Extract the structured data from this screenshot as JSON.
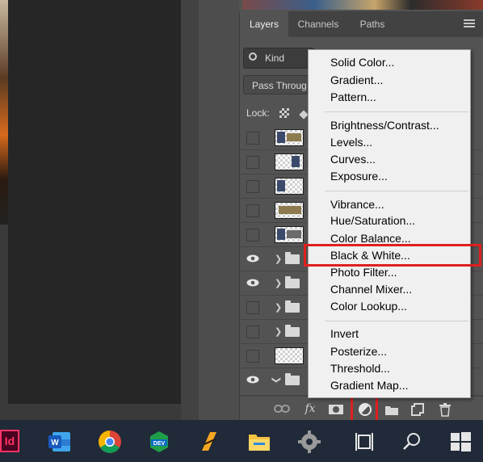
{
  "panel": {
    "tabs": [
      {
        "label": "Layers",
        "active": true
      },
      {
        "label": "Channels",
        "active": false
      },
      {
        "label": "Paths",
        "active": false
      }
    ],
    "filter": {
      "icon": "search-icon",
      "value": "Kind"
    },
    "blend_mode": "Pass Throug",
    "lock_label": "Lock:",
    "layers": [
      {
        "type": "image",
        "visible": false
      },
      {
        "type": "image",
        "visible": false
      },
      {
        "type": "image",
        "visible": false
      },
      {
        "type": "image",
        "visible": false
      },
      {
        "type": "image",
        "visible": false
      },
      {
        "type": "group",
        "visible": true
      },
      {
        "type": "group",
        "visible": true
      },
      {
        "type": "group",
        "visible": false
      },
      {
        "type": "group",
        "visible": false
      },
      {
        "type": "empty",
        "visible": false
      },
      {
        "type": "group-open",
        "visible": true
      }
    ],
    "bottom_tools": [
      "link-icon",
      "fx-icon",
      "mask-icon",
      "adjustment-layer-icon",
      "folder-icon",
      "new-layer-icon",
      "trash-icon"
    ],
    "fx_label": "fx"
  },
  "menu": {
    "groups": [
      [
        "Solid Color...",
        "Gradient...",
        "Pattern..."
      ],
      [
        "Brightness/Contrast...",
        "Levels...",
        "Curves...",
        "Exposure..."
      ],
      [
        "Vibrance...",
        "Hue/Saturation...",
        "Color Balance...",
        "Black & White...",
        "Photo Filter...",
        "Channel Mixer...",
        "Color Lookup..."
      ],
      [
        "Invert",
        "Posterize...",
        "Threshold...",
        "Gradient Map..."
      ]
    ],
    "highlighted": "Black & White..."
  },
  "taskbar": {
    "apps": [
      "indesign-icon",
      "word-icon",
      "chrome-icon",
      "dev-icon",
      "winamp-icon",
      "file-explorer-icon",
      "settings-icon",
      "task-view-icon",
      "search-icon",
      "windows-icon"
    ],
    "indesign_label": "Id",
    "dev_label": "DEV"
  },
  "colors": {
    "highlight": "#e0201e",
    "panel_bg": "#535353",
    "menu_bg": "#f0f0f0",
    "taskbar_bg": "#202a38"
  }
}
